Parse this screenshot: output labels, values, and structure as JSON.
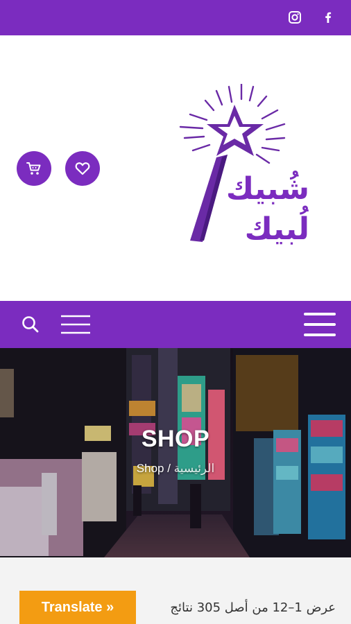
{
  "colors": {
    "brand": "#7b2cbf",
    "translate_button": "#f39c12",
    "background": "#ffffff",
    "content_bg": "#f3f3f3"
  },
  "topbar": {
    "icons": [
      "instagram-icon",
      "facebook-icon"
    ]
  },
  "header": {
    "logo": {
      "line1": "شُبيك",
      "line2": "لُبيك"
    },
    "buttons": [
      "cart-icon",
      "heart-icon"
    ]
  },
  "navbar": {
    "icons": [
      "search-icon",
      "menu-icon",
      "hamburger-icon"
    ]
  },
  "hero": {
    "title": "SHOP",
    "breadcrumb": {
      "home": "الرئيسية",
      "separator": " / ",
      "current": "Shop"
    }
  },
  "content": {
    "translate_label": "Translate »",
    "result_count": "عرض 1–12 من أصل 305 نتائج"
  }
}
